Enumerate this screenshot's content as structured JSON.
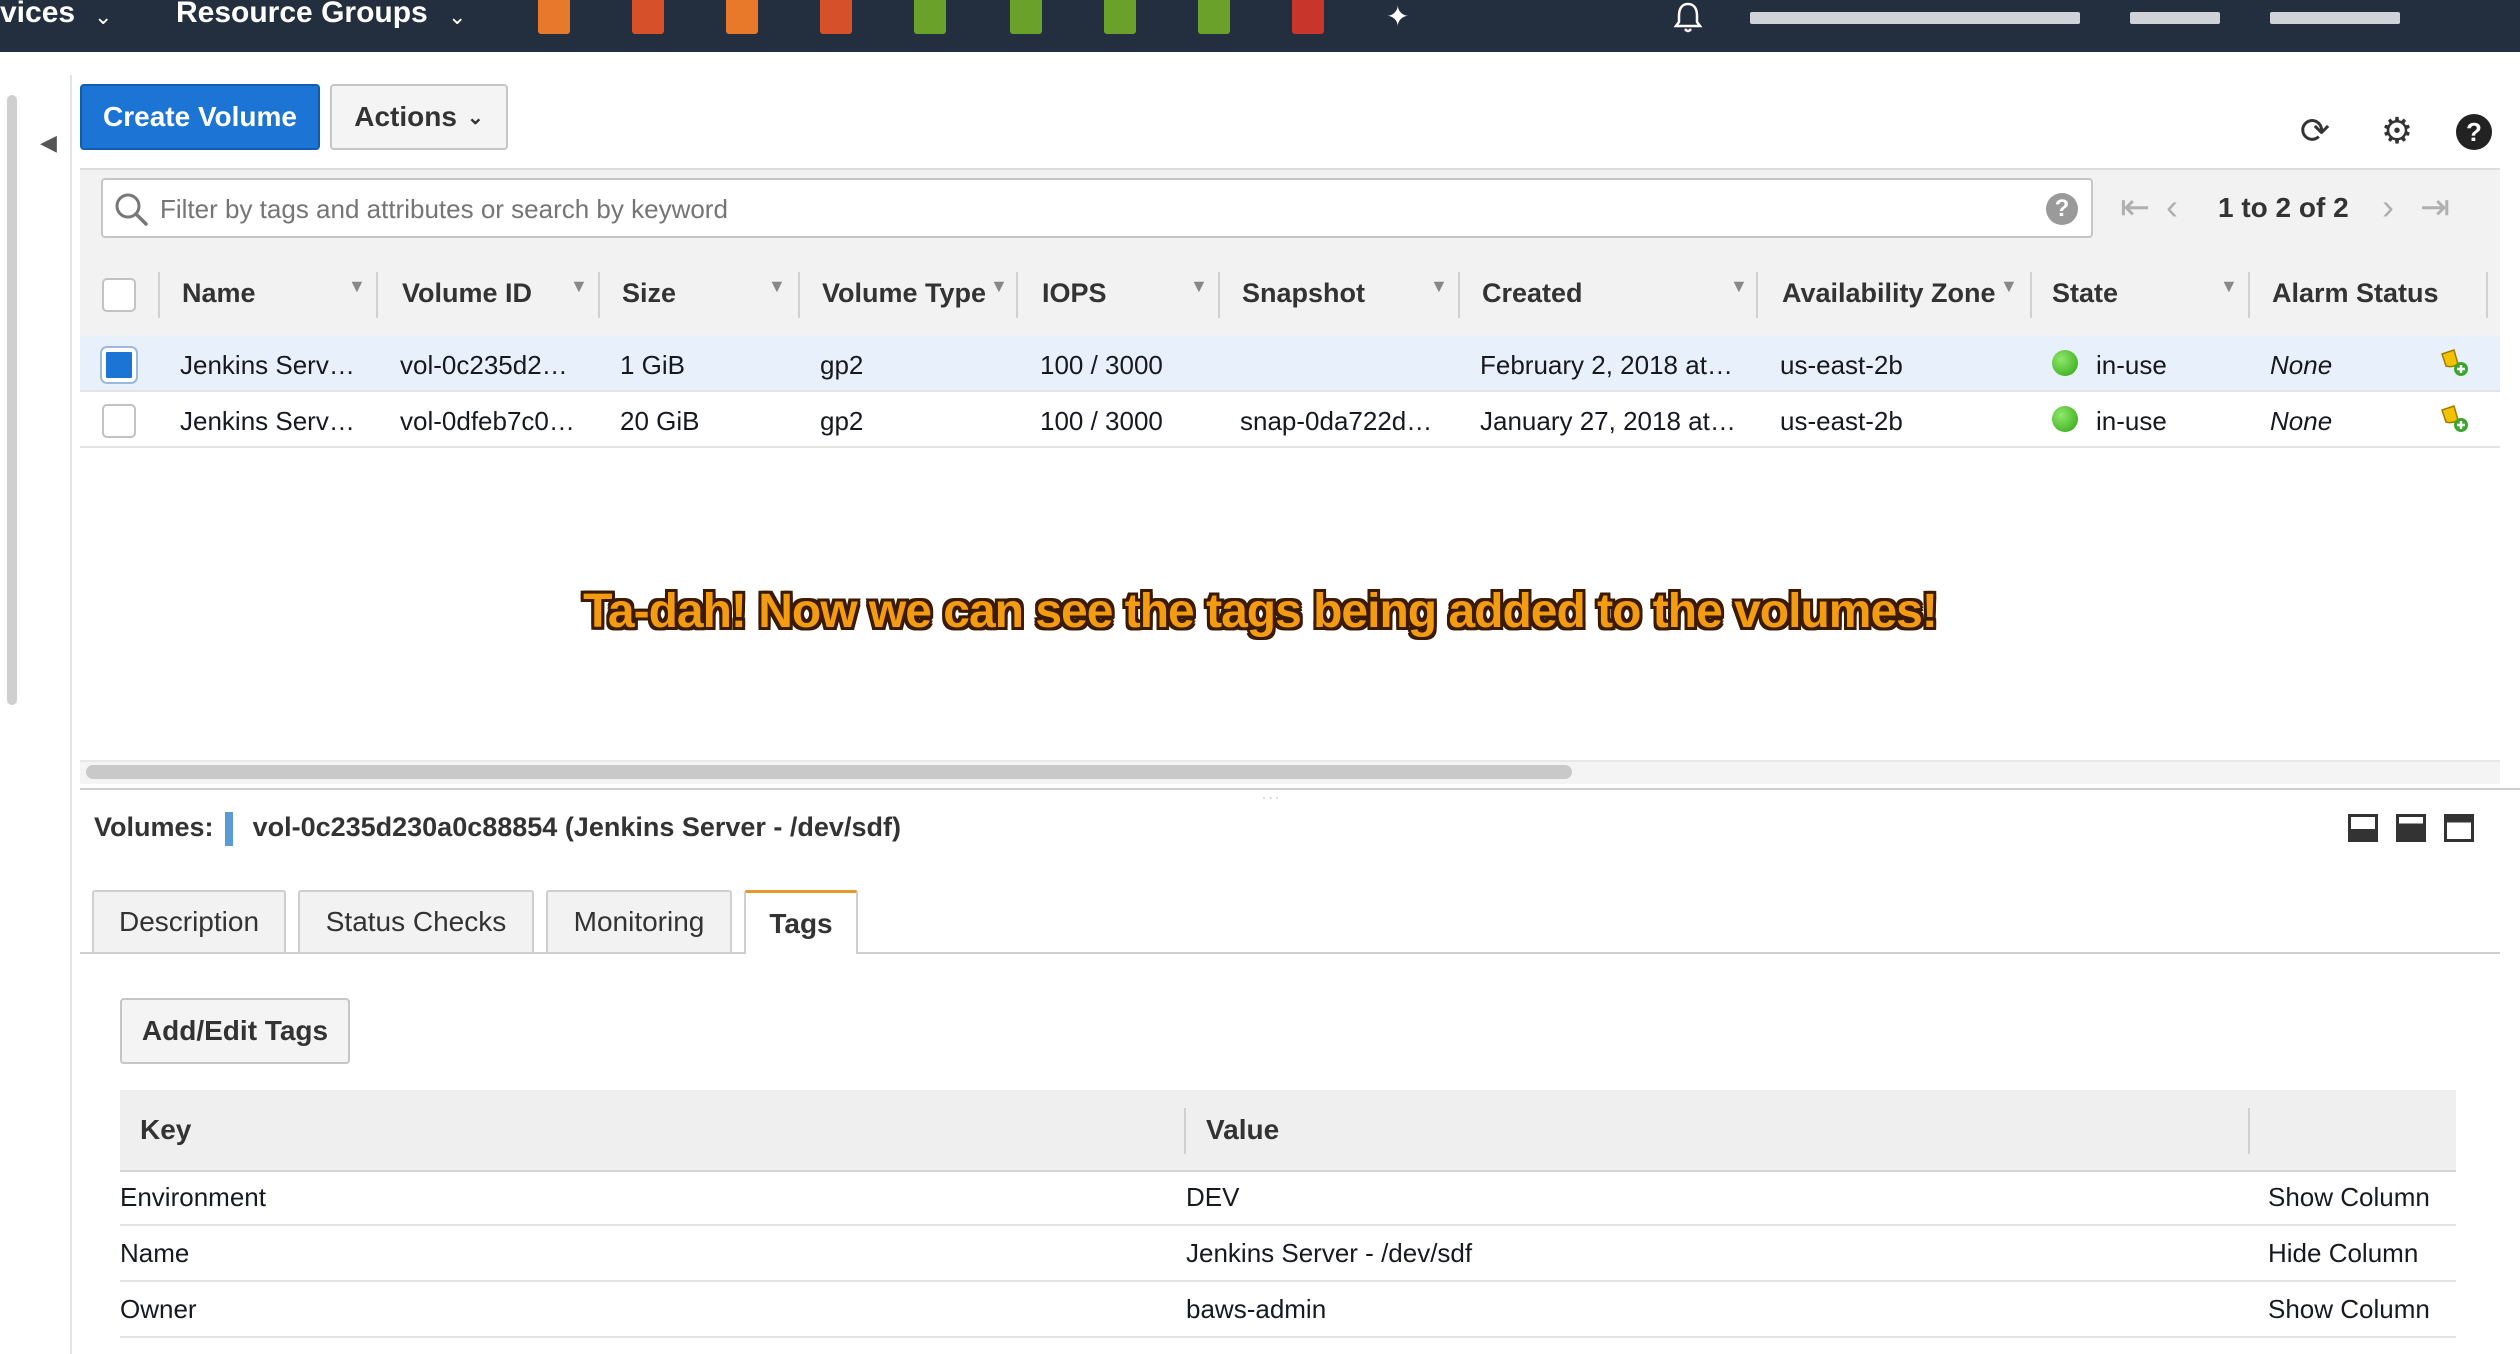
{
  "nav": {
    "services_label": "vices",
    "resource_groups_label": "Resource Groups"
  },
  "toolbar": {
    "create_label": "Create Volume",
    "actions_label": "Actions"
  },
  "search": {
    "placeholder": "Filter by tags and attributes or search by keyword",
    "value": ""
  },
  "pagination": {
    "text": "1 to 2 of 2"
  },
  "table": {
    "columns": [
      "Name",
      "Volume ID",
      "Size",
      "Volume Type",
      "IOPS",
      "Snapshot",
      "Created",
      "Availability Zone",
      "State",
      "Alarm Status"
    ],
    "rows": [
      {
        "selected": true,
        "name": "Jenkins Serv…",
        "volume_id": "vol-0c235d2…",
        "size": "1 GiB",
        "type": "gp2",
        "iops": "100 / 3000",
        "snapshot": "",
        "created": "February 2, 2018 at…",
        "zone": "us-east-2b",
        "state": "in-use",
        "alarm": "None"
      },
      {
        "selected": false,
        "name": "Jenkins Serv…",
        "volume_id": "vol-0dfeb7c0…",
        "size": "20 GiB",
        "type": "gp2",
        "iops": "100 / 3000",
        "snapshot": "snap-0da722d…",
        "created": "January 27, 2018 at…",
        "zone": "us-east-2b",
        "state": "in-use",
        "alarm": "None"
      }
    ]
  },
  "annotation": "Ta-dah! Now we can see the tags being added to the volumes!",
  "detail": {
    "prefix": "Volumes:",
    "title": "vol-0c235d230a0c88854 (Jenkins Server - /dev/sdf)",
    "tabs": [
      "Description",
      "Status Checks",
      "Monitoring",
      "Tags"
    ],
    "active_tab": "Tags",
    "add_edit_label": "Add/Edit Tags",
    "tag_columns": {
      "key": "Key",
      "value": "Value"
    },
    "tags": [
      {
        "key": "Environment",
        "value": "DEV",
        "action": "Show Column"
      },
      {
        "key": "Name",
        "value": "Jenkins Server - /dev/sdf",
        "action": "Hide Column"
      },
      {
        "key": "Owner",
        "value": "baws-admin",
        "action": "Show Column"
      }
    ]
  },
  "colors": {
    "nav_bg": "#232f3e",
    "primary": "#1c74d4",
    "state_ok": "#2ea312",
    "annotation": "#f39c12"
  }
}
